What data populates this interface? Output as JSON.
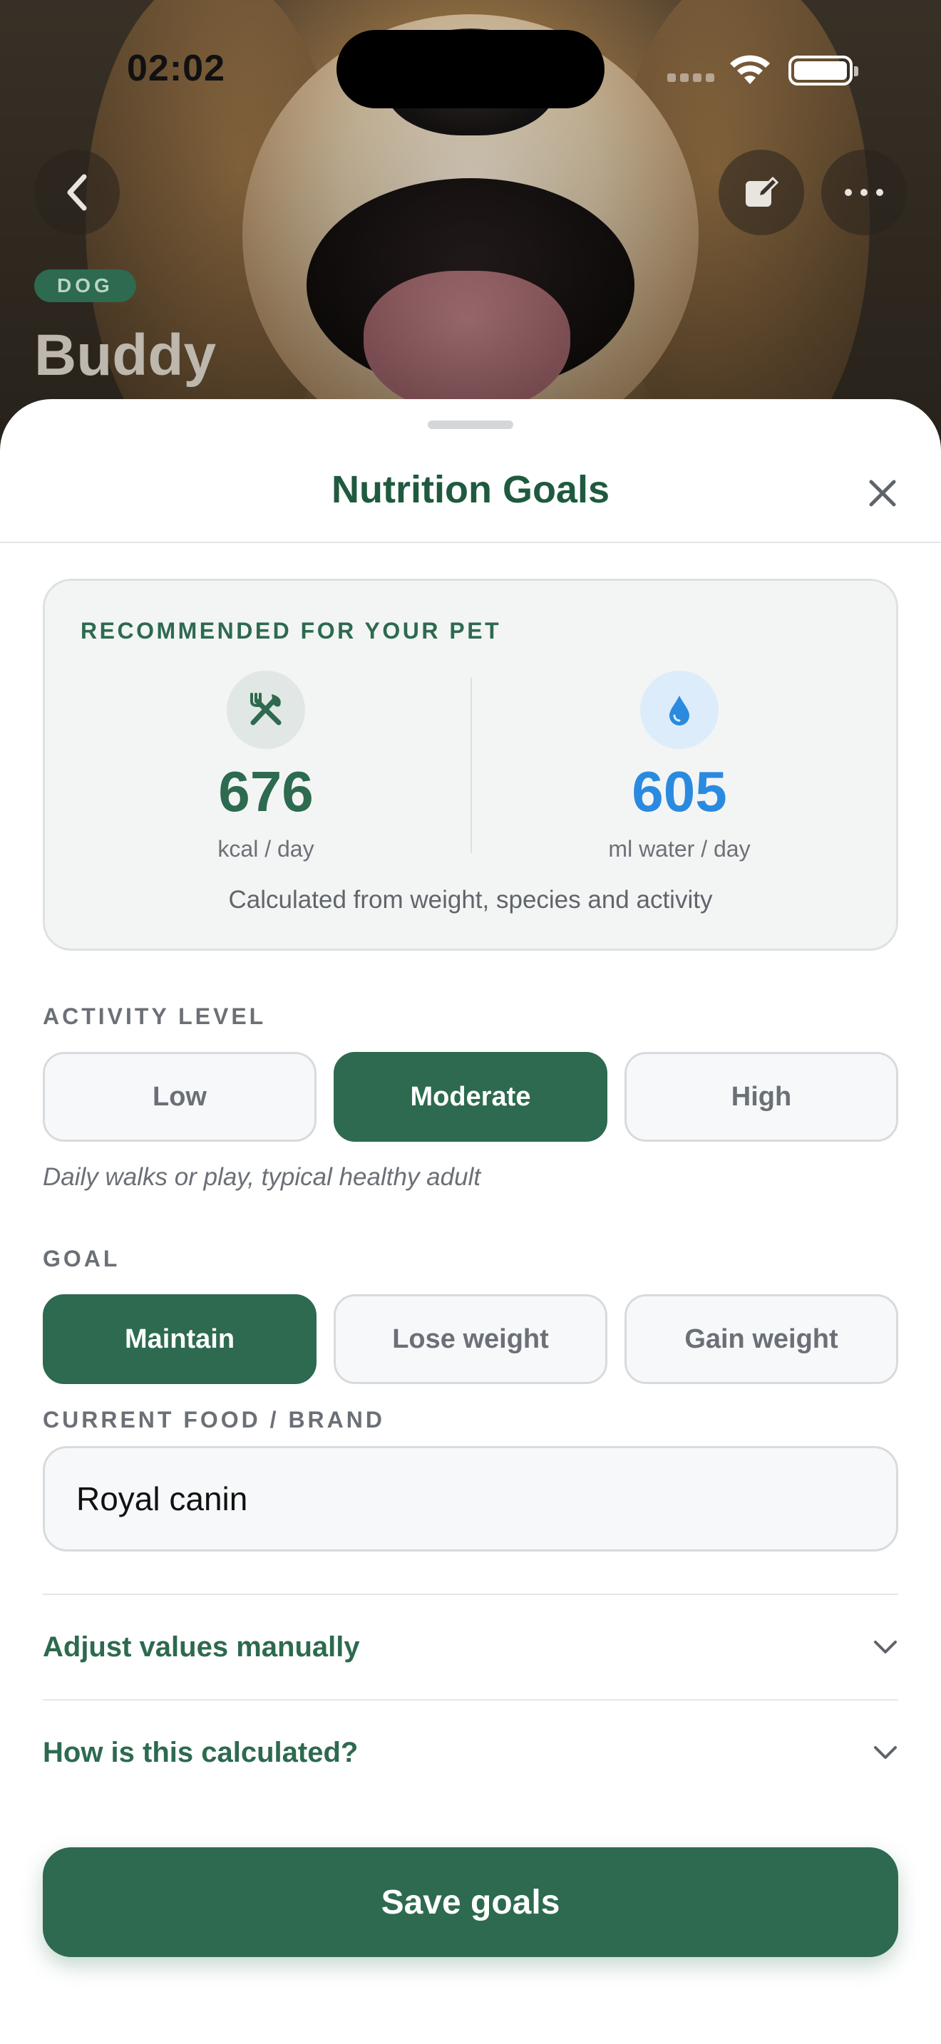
{
  "status_bar": {
    "time": "02:02"
  },
  "hero": {
    "species_badge": "DOG",
    "pet_name": "Buddy"
  },
  "sheet": {
    "title": "Nutrition Goals"
  },
  "recommendation": {
    "title": "RECOMMENDED FOR YOUR PET",
    "food": {
      "value": "676",
      "unit": "kcal / day",
      "icon": "fork-knife-icon"
    },
    "water": {
      "value": "605",
      "unit": "ml water / day",
      "icon": "water-drop-icon"
    },
    "note": "Calculated from weight, species and activity"
  },
  "activity": {
    "label": "ACTIVITY LEVEL",
    "options": [
      "Low",
      "Moderate",
      "High"
    ],
    "selected": "Moderate",
    "helper": "Daily walks or play, typical healthy adult"
  },
  "goal": {
    "label": "GOAL",
    "options": [
      "Maintain",
      "Lose weight",
      "Gain weight"
    ],
    "selected": "Maintain"
  },
  "food_brand": {
    "label": "CURRENT FOOD / BRAND",
    "value": "Royal canin"
  },
  "accordions": [
    {
      "label": "Adjust values manually"
    },
    {
      "label": "How is this calculated?"
    }
  ],
  "save_button": {
    "label": "Save goals"
  },
  "colors": {
    "brand_green": "#2d6a4f",
    "water_blue": "#2a8ae0"
  }
}
